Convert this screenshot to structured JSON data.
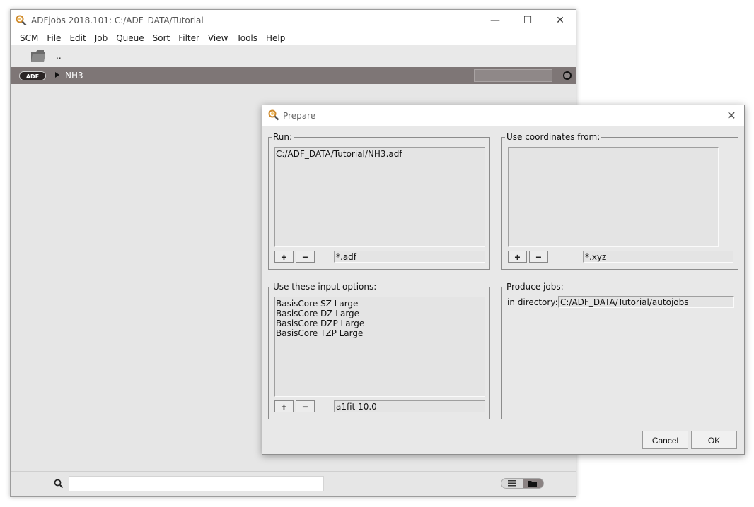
{
  "main_window": {
    "title": "ADFjobs 2018.101: C:/ADF_DATA/Tutorial",
    "controls": {
      "minimize": "—",
      "maximize": "☐",
      "close": "✕"
    },
    "menu": [
      "SCM",
      "File",
      "Edit",
      "Job",
      "Queue",
      "Sort",
      "Filter",
      "View",
      "Tools",
      "Help"
    ],
    "toolbar": {
      "parent_dir": ".."
    },
    "job": {
      "badge": "ADF",
      "name": "NH3"
    },
    "search": {
      "value": "",
      "placeholder": ""
    }
  },
  "dialog": {
    "title": "Prepare",
    "close": "✕",
    "run": {
      "label": "Run:",
      "items": [
        "C:/ADF_DATA/Tutorial/NH3.adf"
      ],
      "add": "+",
      "remove": "−",
      "pattern": "*.adf"
    },
    "coordinates": {
      "label": "Use coordinates from:",
      "items": [],
      "add": "+",
      "remove": "−",
      "pattern": "*.xyz"
    },
    "input_options": {
      "label": "Use these input options:",
      "items": [
        "BasisCore SZ Large",
        "BasisCore DZ Large",
        "BasisCore DZP Large",
        "BasisCore TZP Large"
      ],
      "add": "+",
      "remove": "−",
      "pattern": "a1fit 10.0"
    },
    "produce": {
      "label": "Produce jobs:",
      "dir_label": "in directory:",
      "dir_value": "C:/ADF_DATA/Tutorial/autojobs"
    },
    "buttons": {
      "cancel": "Cancel",
      "ok": "OK"
    }
  },
  "colors": {
    "job_row": "#7e7676",
    "window_bg": "#e6e6e6",
    "dialog_bg": "#e8e8e8"
  }
}
